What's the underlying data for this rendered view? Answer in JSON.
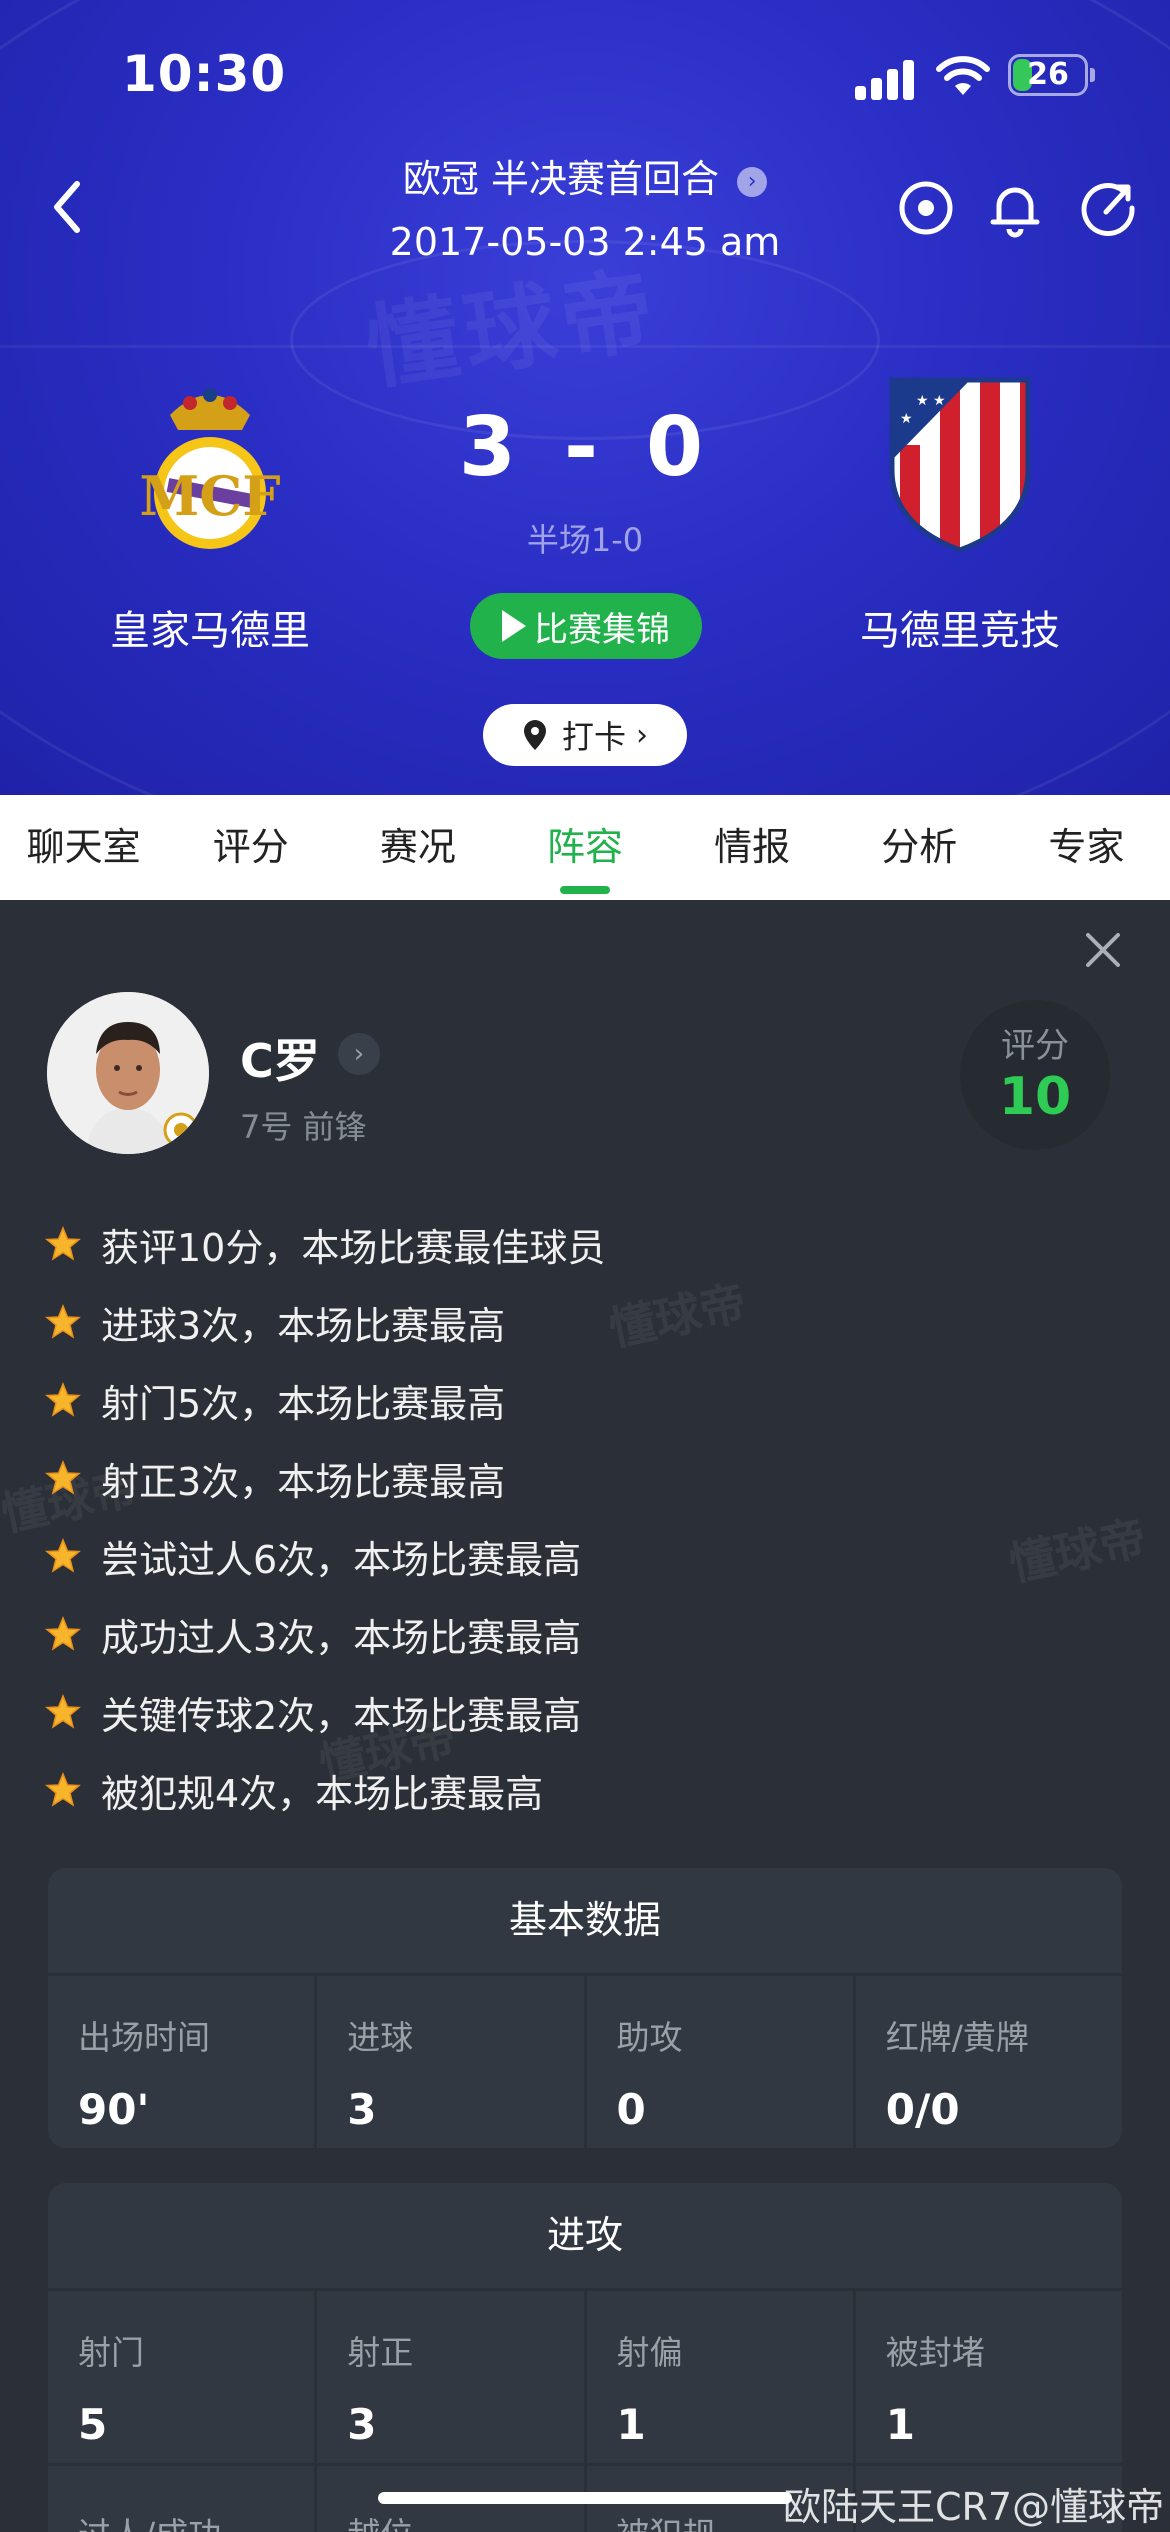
{
  "status_bar": {
    "time": "10:30",
    "battery": "26"
  },
  "header": {
    "competition": "欧冠 半决赛首回合",
    "datetime": "2017-05-03 2:45 am",
    "watermark": "懂球帝",
    "home_team": "皇家马德里",
    "away_team": "马德里竞技",
    "home_score": "3",
    "away_score": "0",
    "score_separator": "-",
    "halftime": "半场1-0",
    "highlight_label": "比赛集锦",
    "checkin_label": "打卡"
  },
  "tabs": [
    "聊天室",
    "评分",
    "赛况",
    "阵容",
    "情报",
    "分析",
    "专家"
  ],
  "active_tab": "阵容",
  "player": {
    "name": "C罗",
    "info": "7号 前锋",
    "rating_label": "评分",
    "rating": "10"
  },
  "achievements": [
    "获评10分，本场比赛最佳球员",
    "进球3次，本场比赛最高",
    "射门5次，本场比赛最高",
    "射正3次，本场比赛最高",
    "尝试过人6次，本场比赛最高",
    "成功过人3次，本场比赛最高",
    "关键传球2次，本场比赛最高",
    "被犯规4次，本场比赛最高"
  ],
  "basic_stats": {
    "title": "基本数据",
    "items": [
      {
        "label": "出场时间",
        "value": "90'"
      },
      {
        "label": "进球",
        "value": "3"
      },
      {
        "label": "助攻",
        "value": "0"
      },
      {
        "label": "红牌/黄牌",
        "value": "0/0"
      }
    ]
  },
  "attack_stats": {
    "title": "进攻",
    "items": [
      {
        "label": "射门",
        "value": "5"
      },
      {
        "label": "射正",
        "value": "3"
      },
      {
        "label": "射偏",
        "value": "1"
      },
      {
        "label": "被封堵",
        "value": "1"
      }
    ],
    "next_labels": [
      "过人/成功",
      "越位",
      "被犯规",
      ""
    ]
  },
  "watermark_text": "懂球帝",
  "credit": "欧陆天王CR7@懂球帝",
  "colors": {
    "accent": "#22b24c",
    "header_bg": "#2a2ec4",
    "rating": "#2ecc55",
    "panel_bg": "#2b3038"
  }
}
